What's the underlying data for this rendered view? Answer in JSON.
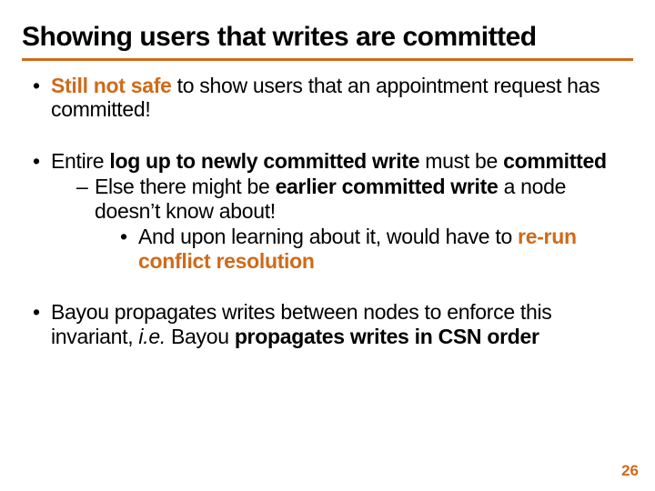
{
  "title": "Showing users that writes are committed",
  "b1": {
    "t1": "Still not safe",
    "t2": " to show users that an appointment request has committed!"
  },
  "b2": {
    "t1": "Entire ",
    "t2": "log up to newly committed write",
    "t3": " must be ",
    "t4": "committed",
    "s1": {
      "t1": "Else there might be ",
      "t2": "earlier committed write",
      "t3": " a node doesn’t know about!",
      "ss1": {
        "t1": "And upon learning about it, would have to ",
        "t2": "re-run conflict resolution"
      }
    }
  },
  "b3": {
    "t1": "Bayou propagates writes between nodes to enforce this invariant, ",
    "t2": "i.e.",
    "t3": " Bayou ",
    "t4": "propagates writes in CSN order"
  },
  "page": "26"
}
